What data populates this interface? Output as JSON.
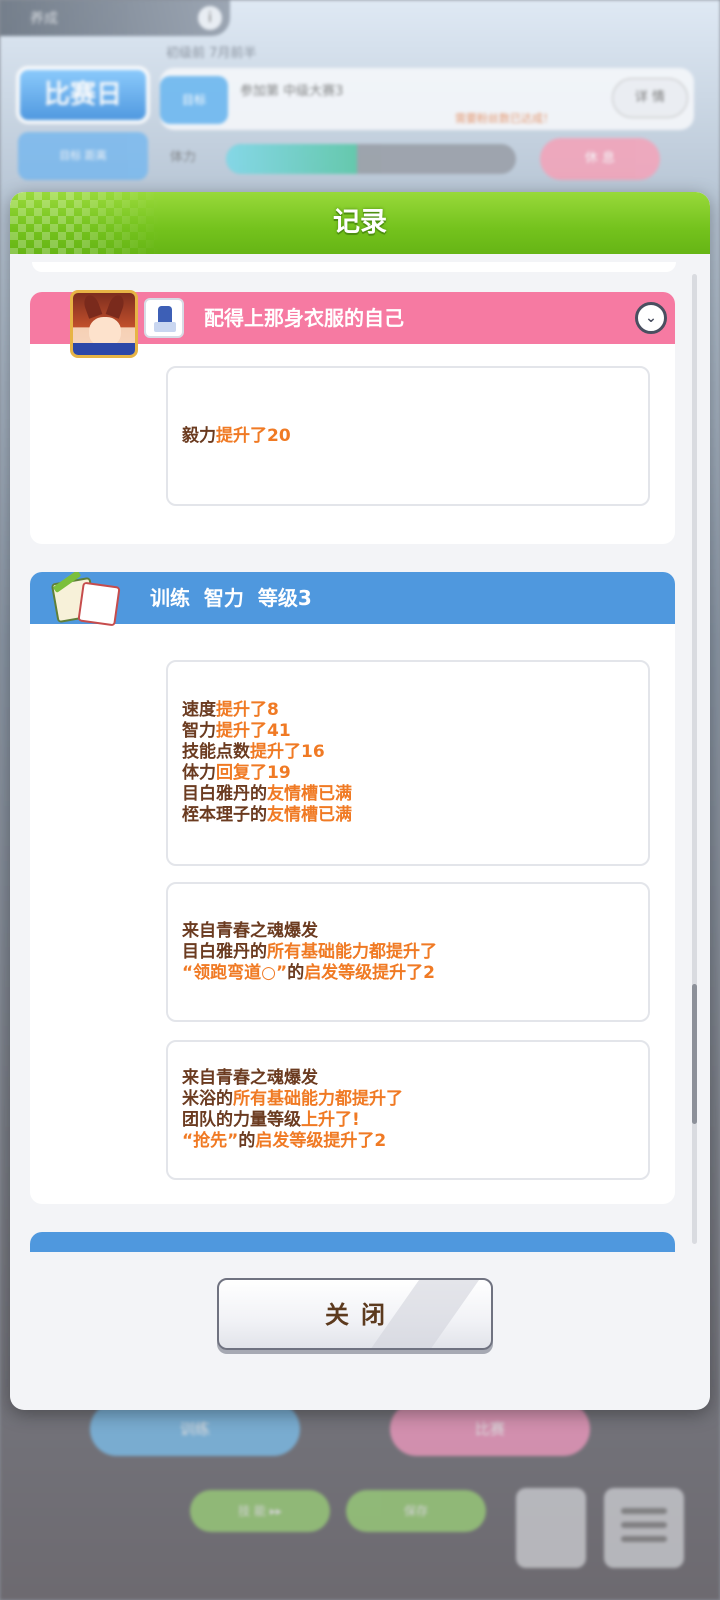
{
  "background": {
    "top_bar_label": "养成",
    "race_badge": "比赛日",
    "small_badge": "目标 距离",
    "date": "初级前 7月前半",
    "goal_tag": "目标",
    "goal_text": "参加第 中级大赛3",
    "goal_note": "需要粉丝数已达成！",
    "detail_button": "详 情",
    "energy_label": "体力",
    "energy_fraction": 0.45,
    "pink_button": "休 息",
    "left_button": "训练",
    "right_button": "比赛",
    "bottom_btn1": "技 能 ▸▸",
    "bottom_btn2": "保存",
    "colors": {
      "pink_button": "#f5a2b8",
      "blue_button": "#7cc0ee"
    }
  },
  "modal": {
    "title": "记录",
    "close_label": "关闭",
    "header_color": "#74c21d",
    "cards": [
      {
        "type": "event",
        "header_color": "#f67aa2",
        "title": "配得上那身衣服的自己",
        "entries": [
          [
            [
              {
                "t": "毅力",
                "hl": false
              },
              {
                "t": "提升了20",
                "hl": true
              }
            ]
          ]
        ]
      },
      {
        "type": "training",
        "header_color": "#4f98de",
        "title": "训练  智力  等级3",
        "entries": [
          [
            [
              {
                "t": "速度",
                "hl": false
              },
              {
                "t": "提升了8",
                "hl": true
              }
            ],
            [
              {
                "t": "智力",
                "hl": false
              },
              {
                "t": "提升了41",
                "hl": true
              }
            ],
            [
              {
                "t": "技能点数",
                "hl": false
              },
              {
                "t": "提升了16",
                "hl": true
              }
            ],
            [
              {
                "t": "体力",
                "hl": false
              },
              {
                "t": "回复了19",
                "hl": true
              }
            ],
            [
              {
                "t": "目白雅丹的",
                "hl": false
              },
              {
                "t": "友情槽已满",
                "hl": true
              }
            ],
            [
              {
                "t": "桎本理子的",
                "hl": false
              },
              {
                "t": "友情槽已满",
                "hl": true
              }
            ]
          ],
          [
            [
              {
                "t": "来自青春之魂爆发",
                "hl": false
              }
            ],
            [
              {
                "t": "目白雅丹的",
                "hl": false
              },
              {
                "t": "所有基础能力都提升了",
                "hl": true
              }
            ],
            [
              {
                "t": "“领跑弯道○”",
                "hl": true
              },
              {
                "t": "的",
                "hl": false
              },
              {
                "t": "启发等级提升了2",
                "hl": true
              }
            ]
          ],
          [
            [
              {
                "t": "来自青春之魂爆发",
                "hl": false
              }
            ],
            [
              {
                "t": "米浴的",
                "hl": false
              },
              {
                "t": "所有基础能力都提升了",
                "hl": true
              }
            ],
            [
              {
                "t": "团队的力量等级",
                "hl": false
              },
              {
                "t": "上升了!",
                "hl": true
              }
            ],
            [
              {
                "t": "“抢先”",
                "hl": true
              },
              {
                "t": "的",
                "hl": false
              },
              {
                "t": "启发等级提升了2",
                "hl": true
              }
            ]
          ]
        ]
      }
    ]
  },
  "icons": [
    "chevron-down-icon",
    "memo-icon",
    "outfit-icon",
    "character-avatar",
    "info-icon",
    "menu-icon"
  ]
}
